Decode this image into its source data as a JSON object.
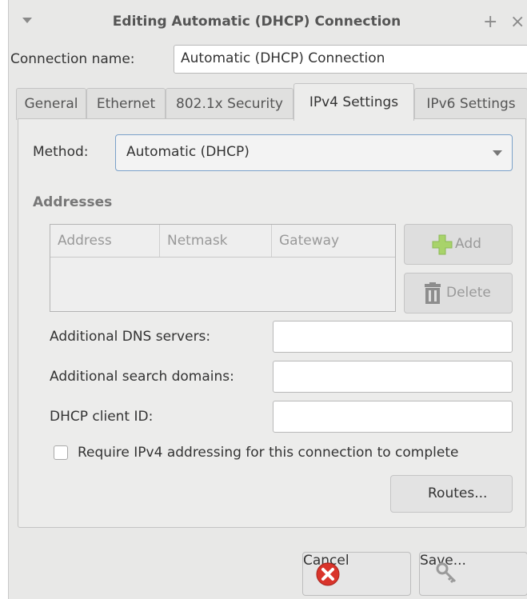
{
  "window": {
    "title": "Editing Automatic (DHCP) Connection",
    "title_buttons": [
      "+",
      "×"
    ]
  },
  "connection_name": {
    "label": "Connection name:",
    "value": "Automatic (DHCP) Connection"
  },
  "tabs": [
    {
      "label": "General"
    },
    {
      "label": "Ethernet"
    },
    {
      "label": "802.1x Security"
    },
    {
      "label": "IPv4 Settings",
      "active": true
    },
    {
      "label": "IPv6 Settings"
    }
  ],
  "ipv4": {
    "method_label": "Method:",
    "method_value": "Automatic (DHCP)",
    "addresses_heading": "Addresses",
    "columns": [
      "Address",
      "Netmask",
      "Gateway"
    ],
    "add_label": "Add",
    "delete_label": "Delete",
    "dns_label": "Additional DNS servers:",
    "dns_value": "",
    "search_label": "Additional search domains:",
    "search_value": "",
    "client_id_label": "DHCP client ID:",
    "client_id_value": "",
    "require_label": "Require IPv4 addressing for this connection to complete",
    "require_checked": false,
    "routes_label": "Routes..."
  },
  "footer": {
    "cancel_label": "Cancel",
    "save_label": "Save..."
  },
  "colors": {
    "cancel_icon": "#d9342b",
    "add_icon": "#8cc63f",
    "focus_border": "#7aa1c9"
  }
}
